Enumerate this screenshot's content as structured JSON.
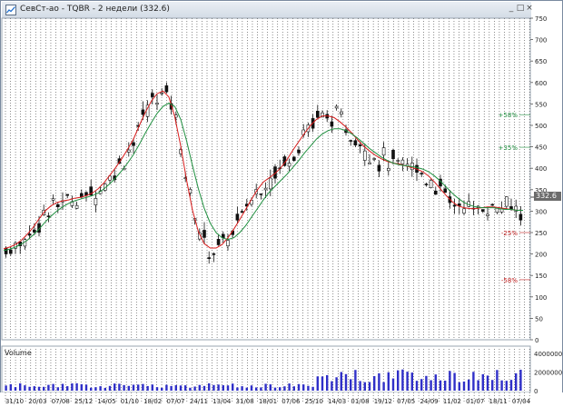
{
  "window": {
    "title": "СевСт-ао - TQBR - 2 недели (332.6)",
    "buttons": [
      "_",
      "□",
      "×"
    ]
  },
  "chart_data": [
    {
      "type": "candlestick",
      "title": "СевСт-ао - TQBR - 2 недели (332.6)",
      "last_price": 332.6,
      "last_price_label": "332.6",
      "x_tick_labels": [
        "31/10",
        "20/03",
        "07/08",
        "25/12",
        "14/05",
        "01/10",
        "18/02",
        "07/07",
        "24/11",
        "13/04",
        "31/08",
        "18/01",
        "07/06",
        "25/10",
        "14/03",
        "01/08",
        "19/12",
        "07/05",
        "24/09",
        "11/02",
        "01/07",
        "18/11",
        "07/04"
      ],
      "y_ticks": [
        0,
        50,
        100,
        150,
        200,
        250,
        300,
        350,
        400,
        450,
        500,
        550,
        600,
        650,
        700,
        750
      ],
      "ylim": [
        0,
        750
      ],
      "grid": "vertical dotted",
      "moving_averages": [
        {
          "color": "#d81b1b",
          "values": [
            212,
            216,
            222,
            232,
            246,
            262,
            282,
            300,
            312,
            320,
            324,
            326,
            330,
            332,
            336,
            342,
            352,
            366,
            384,
            402,
            422,
            444,
            468,
            500,
            530,
            556,
            574,
            580,
            566,
            520,
            452,
            372,
            302,
            252,
            224,
            214,
            214,
            222,
            238,
            258,
            280,
            304,
            328,
            350,
            368,
            378,
            388,
            402,
            420,
            442,
            462,
            482,
            500,
            514,
            522,
            522,
            518,
            508,
            496,
            482,
            466,
            452,
            440,
            430,
            422,
            416,
            412,
            410,
            406,
            402,
            398,
            392,
            382,
            368,
            352,
            336,
            322,
            312,
            308,
            306,
            306,
            308,
            310,
            310,
            308,
            306,
            304,
            302,
            302
          ]
        },
        {
          "color": "#1f8f3f",
          "values": [
            208,
            211,
            216,
            223,
            232,
            244,
            258,
            274,
            288,
            300,
            310,
            318,
            324,
            328,
            332,
            336,
            342,
            352,
            364,
            378,
            394,
            412,
            432,
            456,
            482,
            506,
            528,
            544,
            552,
            544,
            514,
            464,
            406,
            352,
            306,
            272,
            250,
            238,
            234,
            238,
            250,
            266,
            286,
            306,
            326,
            344,
            358,
            372,
            386,
            402,
            418,
            436,
            452,
            468,
            480,
            488,
            492,
            492,
            488,
            480,
            470,
            458,
            446,
            436,
            426,
            418,
            412,
            408,
            406,
            404,
            402,
            398,
            392,
            382,
            370,
            356,
            342,
            330,
            320,
            314,
            310,
            308,
            308,
            308,
            306,
            304,
            304,
            302,
            302
          ]
        }
      ],
      "annotations": [
        {
          "text": "+58%",
          "y": 525,
          "color": "#1f8f3f"
        },
        {
          "text": "+35%",
          "y": 449,
          "color": "#1f8f3f"
        },
        {
          "text": "-25%",
          "y": 250,
          "color": "#c21f1f"
        },
        {
          "text": "-58%",
          "y": 140,
          "color": "#c21f1f"
        }
      ]
    },
    {
      "type": "bar",
      "title": "Volume",
      "y_ticks": [
        0,
        2000000,
        4000000
      ],
      "y_tick_labels": [
        "0",
        "2000000",
        "4000000"
      ],
      "ylim": [
        0,
        4500000
      ],
      "color": "#2f2fc8"
    }
  ]
}
